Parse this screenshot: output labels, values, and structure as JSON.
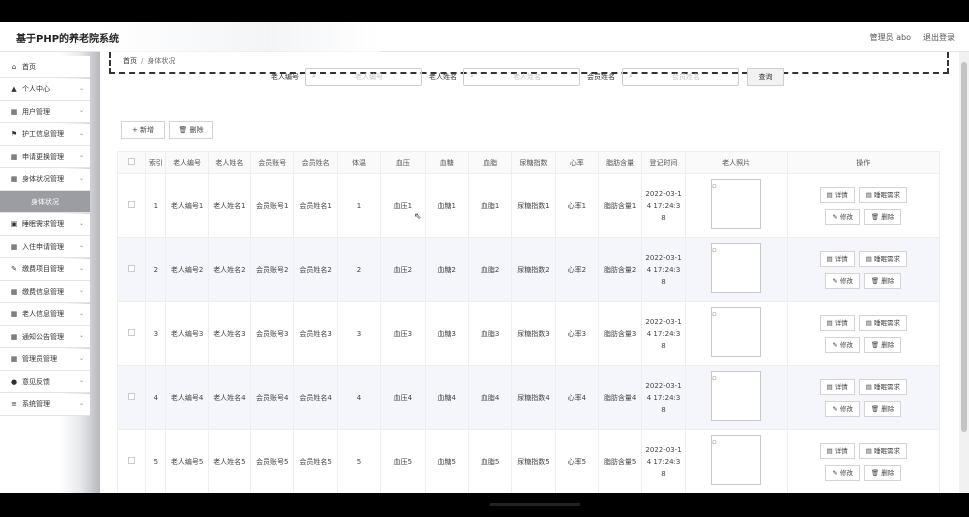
{
  "header": {
    "title": "基于PHP的养老院系统",
    "user_label": "管理员 abo",
    "logout_label": "退出登录"
  },
  "sidebar": {
    "items": [
      {
        "icon": "home-icon",
        "glyph": "⌂",
        "label": "首页",
        "chevron": false
      },
      {
        "icon": "user-icon",
        "glyph": "▲",
        "label": "个人中心",
        "chevron": true
      },
      {
        "icon": "grid-icon",
        "glyph": "▦",
        "label": "用户管理",
        "chevron": true
      },
      {
        "icon": "flag-icon",
        "glyph": "⚑",
        "label": "护工信息管理",
        "chevron": true
      },
      {
        "icon": "grid-icon",
        "glyph": "▦",
        "label": "申请更换管理",
        "chevron": true
      },
      {
        "icon": "grid-icon",
        "glyph": "▦",
        "label": "身体状况管理",
        "chevron": true
      },
      {
        "icon": "",
        "glyph": "",
        "label": "身体状况",
        "chevron": false,
        "active": true
      },
      {
        "icon": "box-icon",
        "glyph": "▣",
        "label": "睡眠需求管理",
        "chevron": true
      },
      {
        "icon": "grid-icon",
        "glyph": "▦",
        "label": "入住申请管理",
        "chevron": true
      },
      {
        "icon": "pen-icon",
        "glyph": "✎",
        "label": "缴费项目管理",
        "chevron": true
      },
      {
        "icon": "grid-icon",
        "glyph": "▦",
        "label": "缴费信息管理",
        "chevron": true
      },
      {
        "icon": "grid-icon",
        "glyph": "▦",
        "label": "老人信息管理",
        "chevron": true
      },
      {
        "icon": "grid-icon",
        "glyph": "▦",
        "label": "通知公告管理",
        "chevron": true
      },
      {
        "icon": "grid-icon",
        "glyph": "▦",
        "label": "管理员管理",
        "chevron": true
      },
      {
        "icon": "pin-icon",
        "glyph": "●",
        "label": "意见反馈",
        "chevron": true
      },
      {
        "icon": "menu-icon",
        "glyph": "≡",
        "label": "系统管理",
        "chevron": true
      }
    ]
  },
  "breadcrumb": {
    "home": "首页",
    "sep": "/",
    "current": "身体状况"
  },
  "search": {
    "fields": [
      {
        "label": "老人编号",
        "placeholder": "老人编号"
      },
      {
        "label": "老人姓名",
        "placeholder": "老人姓名"
      },
      {
        "label": "会员姓名",
        "placeholder": "会员姓名"
      }
    ],
    "button": "查询"
  },
  "toolbar": {
    "add_label": "+ 新增",
    "delete_label": "🗑 删除"
  },
  "table": {
    "headers": [
      "",
      "索引",
      "老人编号",
      "老人姓名",
      "会员账号",
      "会员姓名",
      "体温",
      "血压",
      "血糖",
      "血脂",
      "尿糖指数",
      "心率",
      "脂肪含量",
      "登记时间",
      "老人照片",
      "操作"
    ],
    "rows": [
      [
        "",
        "1",
        "老人编号1",
        "老人姓名1",
        "会员账号1",
        "会员姓名1",
        "1",
        "血压1",
        "血糖1",
        "血脂1",
        "尿糖指数1",
        "心率1",
        "脂肪含量1",
        "2022-03-14 17:24:38"
      ],
      [
        "",
        "2",
        "老人编号2",
        "老人姓名2",
        "会员账号2",
        "会员姓名2",
        "2",
        "血压2",
        "血糖2",
        "血脂2",
        "尿糖指数2",
        "心率2",
        "脂肪含量2",
        "2022-03-14 17:24:38"
      ],
      [
        "",
        "3",
        "老人编号3",
        "老人姓名3",
        "会员账号3",
        "会员姓名3",
        "3",
        "血压3",
        "血糖3",
        "血脂3",
        "尿糖指数3",
        "心率3",
        "脂肪含量3",
        "2022-03-14 17:24:38"
      ],
      [
        "",
        "4",
        "老人编号4",
        "老人姓名4",
        "会员账号4",
        "会员姓名4",
        "4",
        "血压4",
        "血糖4",
        "血脂4",
        "尿糖指数4",
        "心率4",
        "脂肪含量4",
        "2022-03-14 17:24:38"
      ],
      [
        "",
        "5",
        "老人编号5",
        "老人姓名5",
        "会员账号5",
        "会员姓名5",
        "5",
        "血压5",
        "血糖5",
        "血脂5",
        "尿糖指数5",
        "心率5",
        "脂肪含量5",
        "2022-03-14 17:24:38"
      ]
    ],
    "actions": {
      "detail": "详情",
      "sleep": "睡眠需求",
      "edit": "修改",
      "delete": "删除"
    }
  }
}
